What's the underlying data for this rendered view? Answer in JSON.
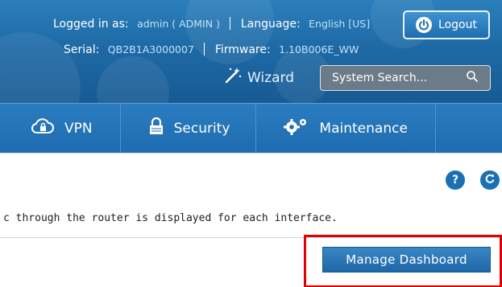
{
  "header": {
    "logged_in_label": "Logged in as:",
    "user": "admin ( ADMIN )",
    "language_label": "Language:",
    "language": "English [US]",
    "serial_label": "Serial:",
    "serial": "QB2B1A3000007",
    "firmware_label": "Firmware:",
    "firmware": "1.10B006E_WW",
    "logout_label": "Logout",
    "wizard_label": "Wizard",
    "search_placeholder": "System Search..."
  },
  "nav": {
    "items": [
      {
        "label": "VPN",
        "icon": "cloud-lock-icon"
      },
      {
        "label": "Security",
        "icon": "lock-icon"
      },
      {
        "label": "Maintenance",
        "icon": "gears-icon"
      }
    ]
  },
  "content": {
    "help_label": "?",
    "description": "c through the router is displayed for each interface.",
    "manage_button": "Manage Dashboard"
  },
  "colors": {
    "header_blue": "#1e6aa6",
    "nav_blue": "#1f6cb0",
    "highlight_red": "#e00000"
  }
}
